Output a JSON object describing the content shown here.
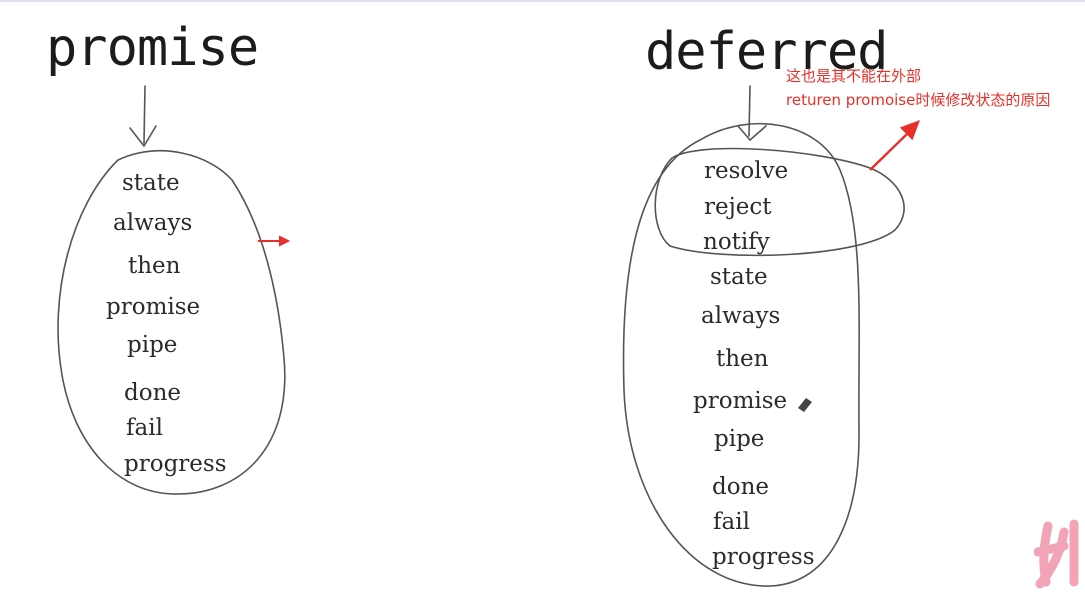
{
  "left_group": {
    "heading": "promise",
    "methods": [
      "state",
      "always",
      "then",
      "promise",
      "pipe",
      "done",
      "fail",
      "progress"
    ]
  },
  "right_group": {
    "heading": "deferred",
    "methods": [
      "resolve",
      "reject",
      "notify",
      "state",
      "always",
      "then",
      "promise",
      "pipe",
      "done",
      "fail",
      "progress"
    ]
  },
  "annotation": {
    "line1": "这也是其不能在外部",
    "line2": "returen promoise时候修改状态的原因",
    "color": "#e8302a"
  },
  "colors": {
    "ink": "#2b2b2b",
    "arrow": "#e8302a",
    "watermark": "#f2a3b5"
  }
}
